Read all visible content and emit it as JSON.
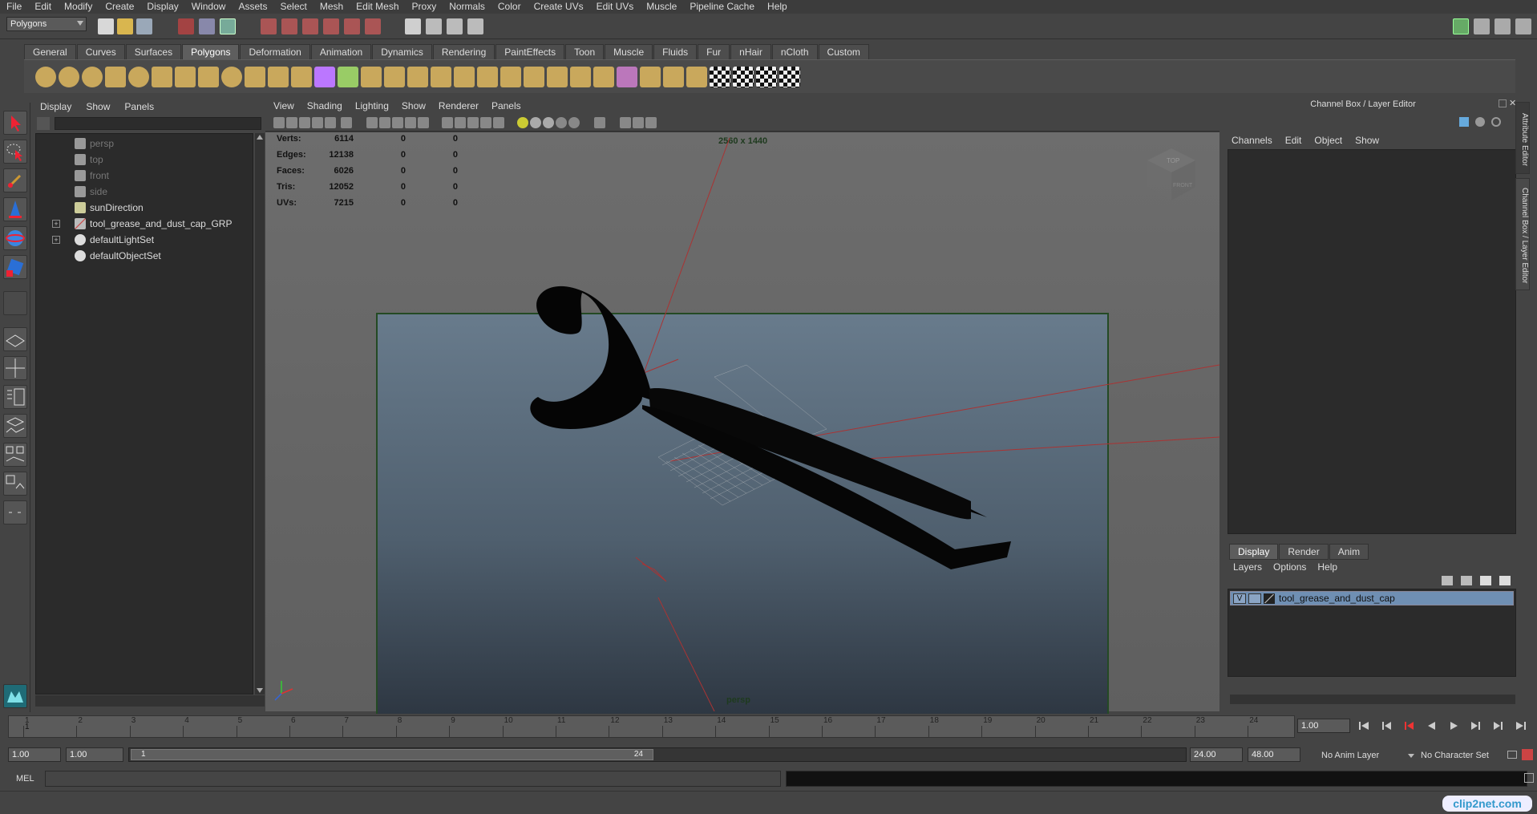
{
  "menubar": [
    "File",
    "Edit",
    "Modify",
    "Create",
    "Display",
    "Window",
    "Assets",
    "Select",
    "Mesh",
    "Edit Mesh",
    "Proxy",
    "Normals",
    "Color",
    "Create UVs",
    "Edit UVs",
    "Muscle",
    "Pipeline Cache",
    "Help"
  ],
  "status": {
    "mode": "Polygons"
  },
  "shelf_tabs": [
    "General",
    "Curves",
    "Surfaces",
    "Polygons",
    "Deformation",
    "Animation",
    "Dynamics",
    "Rendering",
    "PaintEffects",
    "Toon",
    "Muscle",
    "Fluids",
    "Fur",
    "nHair",
    "nCloth",
    "Custom"
  ],
  "shelf_active": "Polygons",
  "outliner": {
    "menu": [
      "Display",
      "Show",
      "Panels"
    ],
    "items": [
      {
        "label": "persp",
        "icon": "camera-icon",
        "dim": true
      },
      {
        "label": "top",
        "icon": "camera-icon",
        "dim": true
      },
      {
        "label": "front",
        "icon": "camera-icon",
        "dim": true
      },
      {
        "label": "side",
        "icon": "camera-icon",
        "dim": true
      },
      {
        "label": "sunDirection",
        "icon": "directional-light-icon",
        "dim": false
      },
      {
        "label": "tool_grease_and_dust_cap_GRP",
        "icon": "group-icon",
        "dim": false,
        "expand": true
      },
      {
        "label": "defaultLightSet",
        "icon": "set-icon",
        "dim": false,
        "expand": true
      },
      {
        "label": "defaultObjectSet",
        "icon": "set-icon",
        "dim": false
      }
    ]
  },
  "viewport": {
    "menu": [
      "View",
      "Shading",
      "Lighting",
      "Show",
      "Renderer",
      "Panels"
    ],
    "hud": [
      {
        "label": "Verts:",
        "v1": "6114",
        "v2": "0",
        "v3": "0"
      },
      {
        "label": "Edges:",
        "v1": "12138",
        "v2": "0",
        "v3": "0"
      },
      {
        "label": "Faces:",
        "v1": "6026",
        "v2": "0",
        "v3": "0"
      },
      {
        "label": "Tris:",
        "v1": "12052",
        "v2": "0",
        "v3": "0"
      },
      {
        "label": "UVs:",
        "v1": "7215",
        "v2": "0",
        "v3": "0"
      }
    ],
    "resolution": "2560 x 1440",
    "camera": "persp",
    "viewcube_top": "TOP",
    "viewcube_front": "FRONT"
  },
  "channel_box": {
    "title": "Channel Box / Layer Editor",
    "menu": [
      "Channels",
      "Edit",
      "Object",
      "Show"
    ],
    "side_tabs": [
      "Attribute Editor",
      "Channel Box / Layer Editor"
    ]
  },
  "layer_editor": {
    "tabs": [
      "Display",
      "Render",
      "Anim"
    ],
    "active_tab": "Display",
    "menu": [
      "Layers",
      "Options",
      "Help"
    ],
    "layer": {
      "visibility": "V",
      "name": "tool_grease_and_dust_cap"
    }
  },
  "timeline": {
    "ticks": [
      "1",
      "2",
      "3",
      "4",
      "5",
      "6",
      "7",
      "8",
      "9",
      "10",
      "11",
      "12",
      "13",
      "14",
      "15",
      "16",
      "17",
      "18",
      "19",
      "20",
      "21",
      "22",
      "23",
      "24"
    ],
    "current_frame_marker": "1",
    "current_time": "1.00"
  },
  "range": {
    "start": "1.00",
    "start2": "1.00",
    "slider_start": "1",
    "slider_end": "24",
    "end": "24.00",
    "end2": "48.00",
    "anim_layer": "No Anim Layer",
    "char_set": "No Character Set"
  },
  "cmdline": {
    "label": "MEL"
  },
  "watermark": "clip2net.com"
}
